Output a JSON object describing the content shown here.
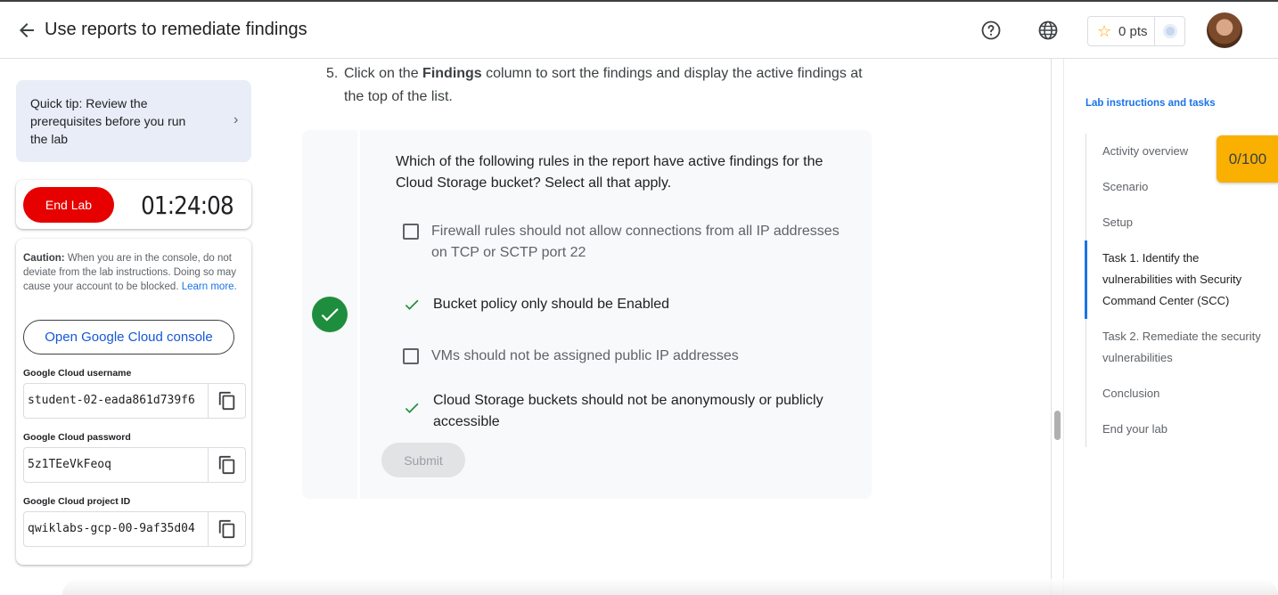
{
  "header": {
    "title": "Use reports to remediate findings",
    "back_icon": "arrow-left-icon",
    "help_icon": "help-circle-icon",
    "language_icon": "globe-icon",
    "points": "0 pts"
  },
  "tip": {
    "text": "Quick tip: Review the prerequisites before you run the lab"
  },
  "timer_card": {
    "end_lab_label": "End Lab",
    "time": "01:24:08"
  },
  "credentials": {
    "caution_bold": "Caution:",
    "caution_text": " When you are in the console, do not deviate from the lab instructions. Doing so may cause your account to be blocked.",
    "learn_more": "Learn more.",
    "open_console_label": "Open Google Cloud console",
    "username_label": "Google Cloud username",
    "username_value": "student-02-eada861d739f6",
    "password_label": "Google Cloud password",
    "password_value": "5z1TEeVkFeoq",
    "project_label": "Google Cloud project ID",
    "project_value": "qwiklabs-gcp-00-9af35d04"
  },
  "step": {
    "number": "5.",
    "text_before": "Click on the ",
    "bold": "Findings",
    "text_after": " column to sort the findings and display the active findings at the top of the list."
  },
  "quiz": {
    "question": "Which of the following rules in the report have active findings for the Cloud Storage bucket? Select all that apply.",
    "options": [
      {
        "label": "Firewall rules should not allow connections from all IP addresses on TCP or SCTP port 22",
        "selected": false
      },
      {
        "label": "Bucket policy only should be Enabled",
        "selected": true
      },
      {
        "label": "VMs should not be assigned public IP addresses",
        "selected": false
      },
      {
        "label": "Cloud Storage buckets should not be anonymously or publicly accessible",
        "selected": true
      }
    ],
    "submit_label": "Submit",
    "accent": "#1e8e3e"
  },
  "toc": {
    "title": "Lab instructions and tasks",
    "items": [
      "Activity overview",
      "Scenario",
      "Setup",
      "Task 1. Identify the vulnerabilities with Security Command Center (SCC)",
      "Task 2. Remediate the security vulnerabilities",
      "Conclusion",
      "End your lab"
    ],
    "active_index": 3
  },
  "score": "0/100"
}
